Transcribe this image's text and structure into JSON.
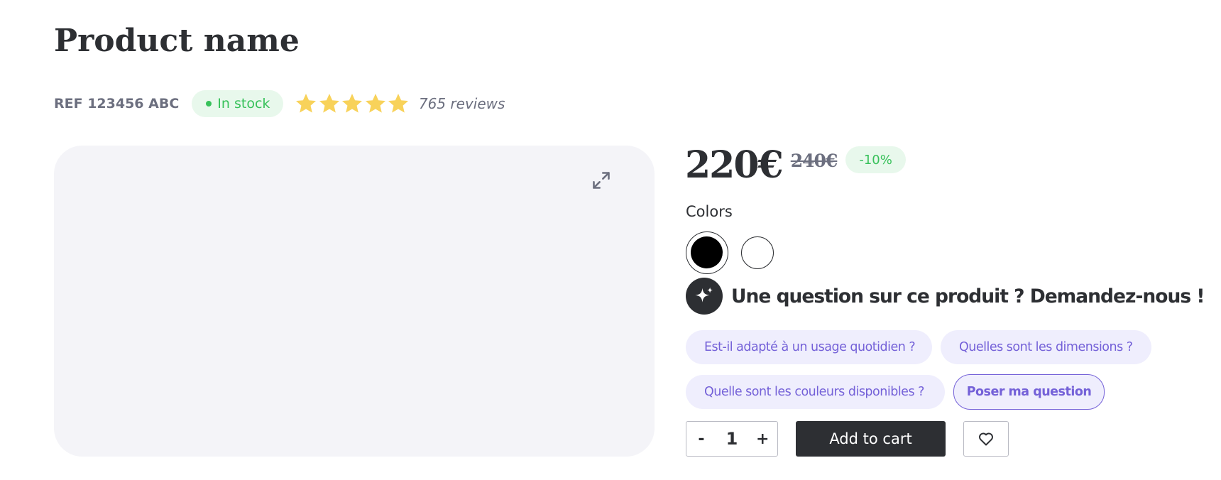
{
  "product": {
    "name": "Product name",
    "reference": "REF 123456 ABC",
    "stock_status": "In stock",
    "rating": 5,
    "rating_max": 5,
    "reviews_label": "765 reviews"
  },
  "pricing": {
    "price": "220€",
    "old_price": "240€",
    "discount": "-10%"
  },
  "colors": {
    "label": "Colors",
    "options": [
      {
        "name": "black",
        "hex": "#000000",
        "selected": true
      },
      {
        "name": "white",
        "hex": "#ffffff",
        "selected": false
      }
    ]
  },
  "ask": {
    "heading": "Une question sur ce produit ? Demandez-nous !",
    "suggestions": [
      "Est-il adapté à un usage quotidien ?",
      "Quelles sont les dimensions ?",
      "Quelle sont les couleurs disponibles ?"
    ],
    "ask_button": "Poser ma question"
  },
  "cart": {
    "decrement": "-",
    "quantity": "1",
    "increment": "+",
    "add_label": "Add to cart"
  },
  "icons": {
    "expand": "expand-icon",
    "sparkle": "sparkle-icon",
    "heart": "heart-icon",
    "star": "star-icon"
  },
  "theme": {
    "dark": "#2d2f33",
    "muted": "#6c6f7f",
    "success": "#37c15a",
    "success_bg": "#e8f8ec",
    "accent": "#7461d8",
    "accent_bg": "#efeefd",
    "star": "#f8d25a",
    "image_bg": "#f4f4f8"
  }
}
